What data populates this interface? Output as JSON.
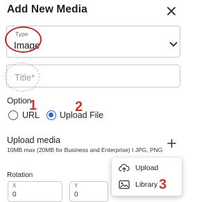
{
  "header": {
    "title": "Add New Media"
  },
  "type_field": {
    "label": "Type",
    "value": "Image"
  },
  "title_field": {
    "placeholder": "Title*"
  },
  "option": {
    "label": "Option",
    "choices": [
      {
        "label": "URL",
        "selected": false
      },
      {
        "label": "Upload File",
        "selected": true
      }
    ]
  },
  "upload_media": {
    "title": "Upload media",
    "subtitle": "10MB max (20MB for Business and Enterprise) I JPG, PNG"
  },
  "rotation": {
    "label": "Rotation",
    "x_label": "X",
    "x_value": "0",
    "y_label": "Y",
    "y_value": "0"
  },
  "menu": {
    "items": [
      {
        "label": "Upload",
        "icon": "cloud-upload-icon"
      },
      {
        "label": "Library",
        "icon": "image-library-icon"
      }
    ]
  },
  "annotations": {
    "n1": "1",
    "n2": "2",
    "n3": "3"
  },
  "colors": {
    "accent": "#2666d6",
    "annotation": "#c43a31"
  }
}
